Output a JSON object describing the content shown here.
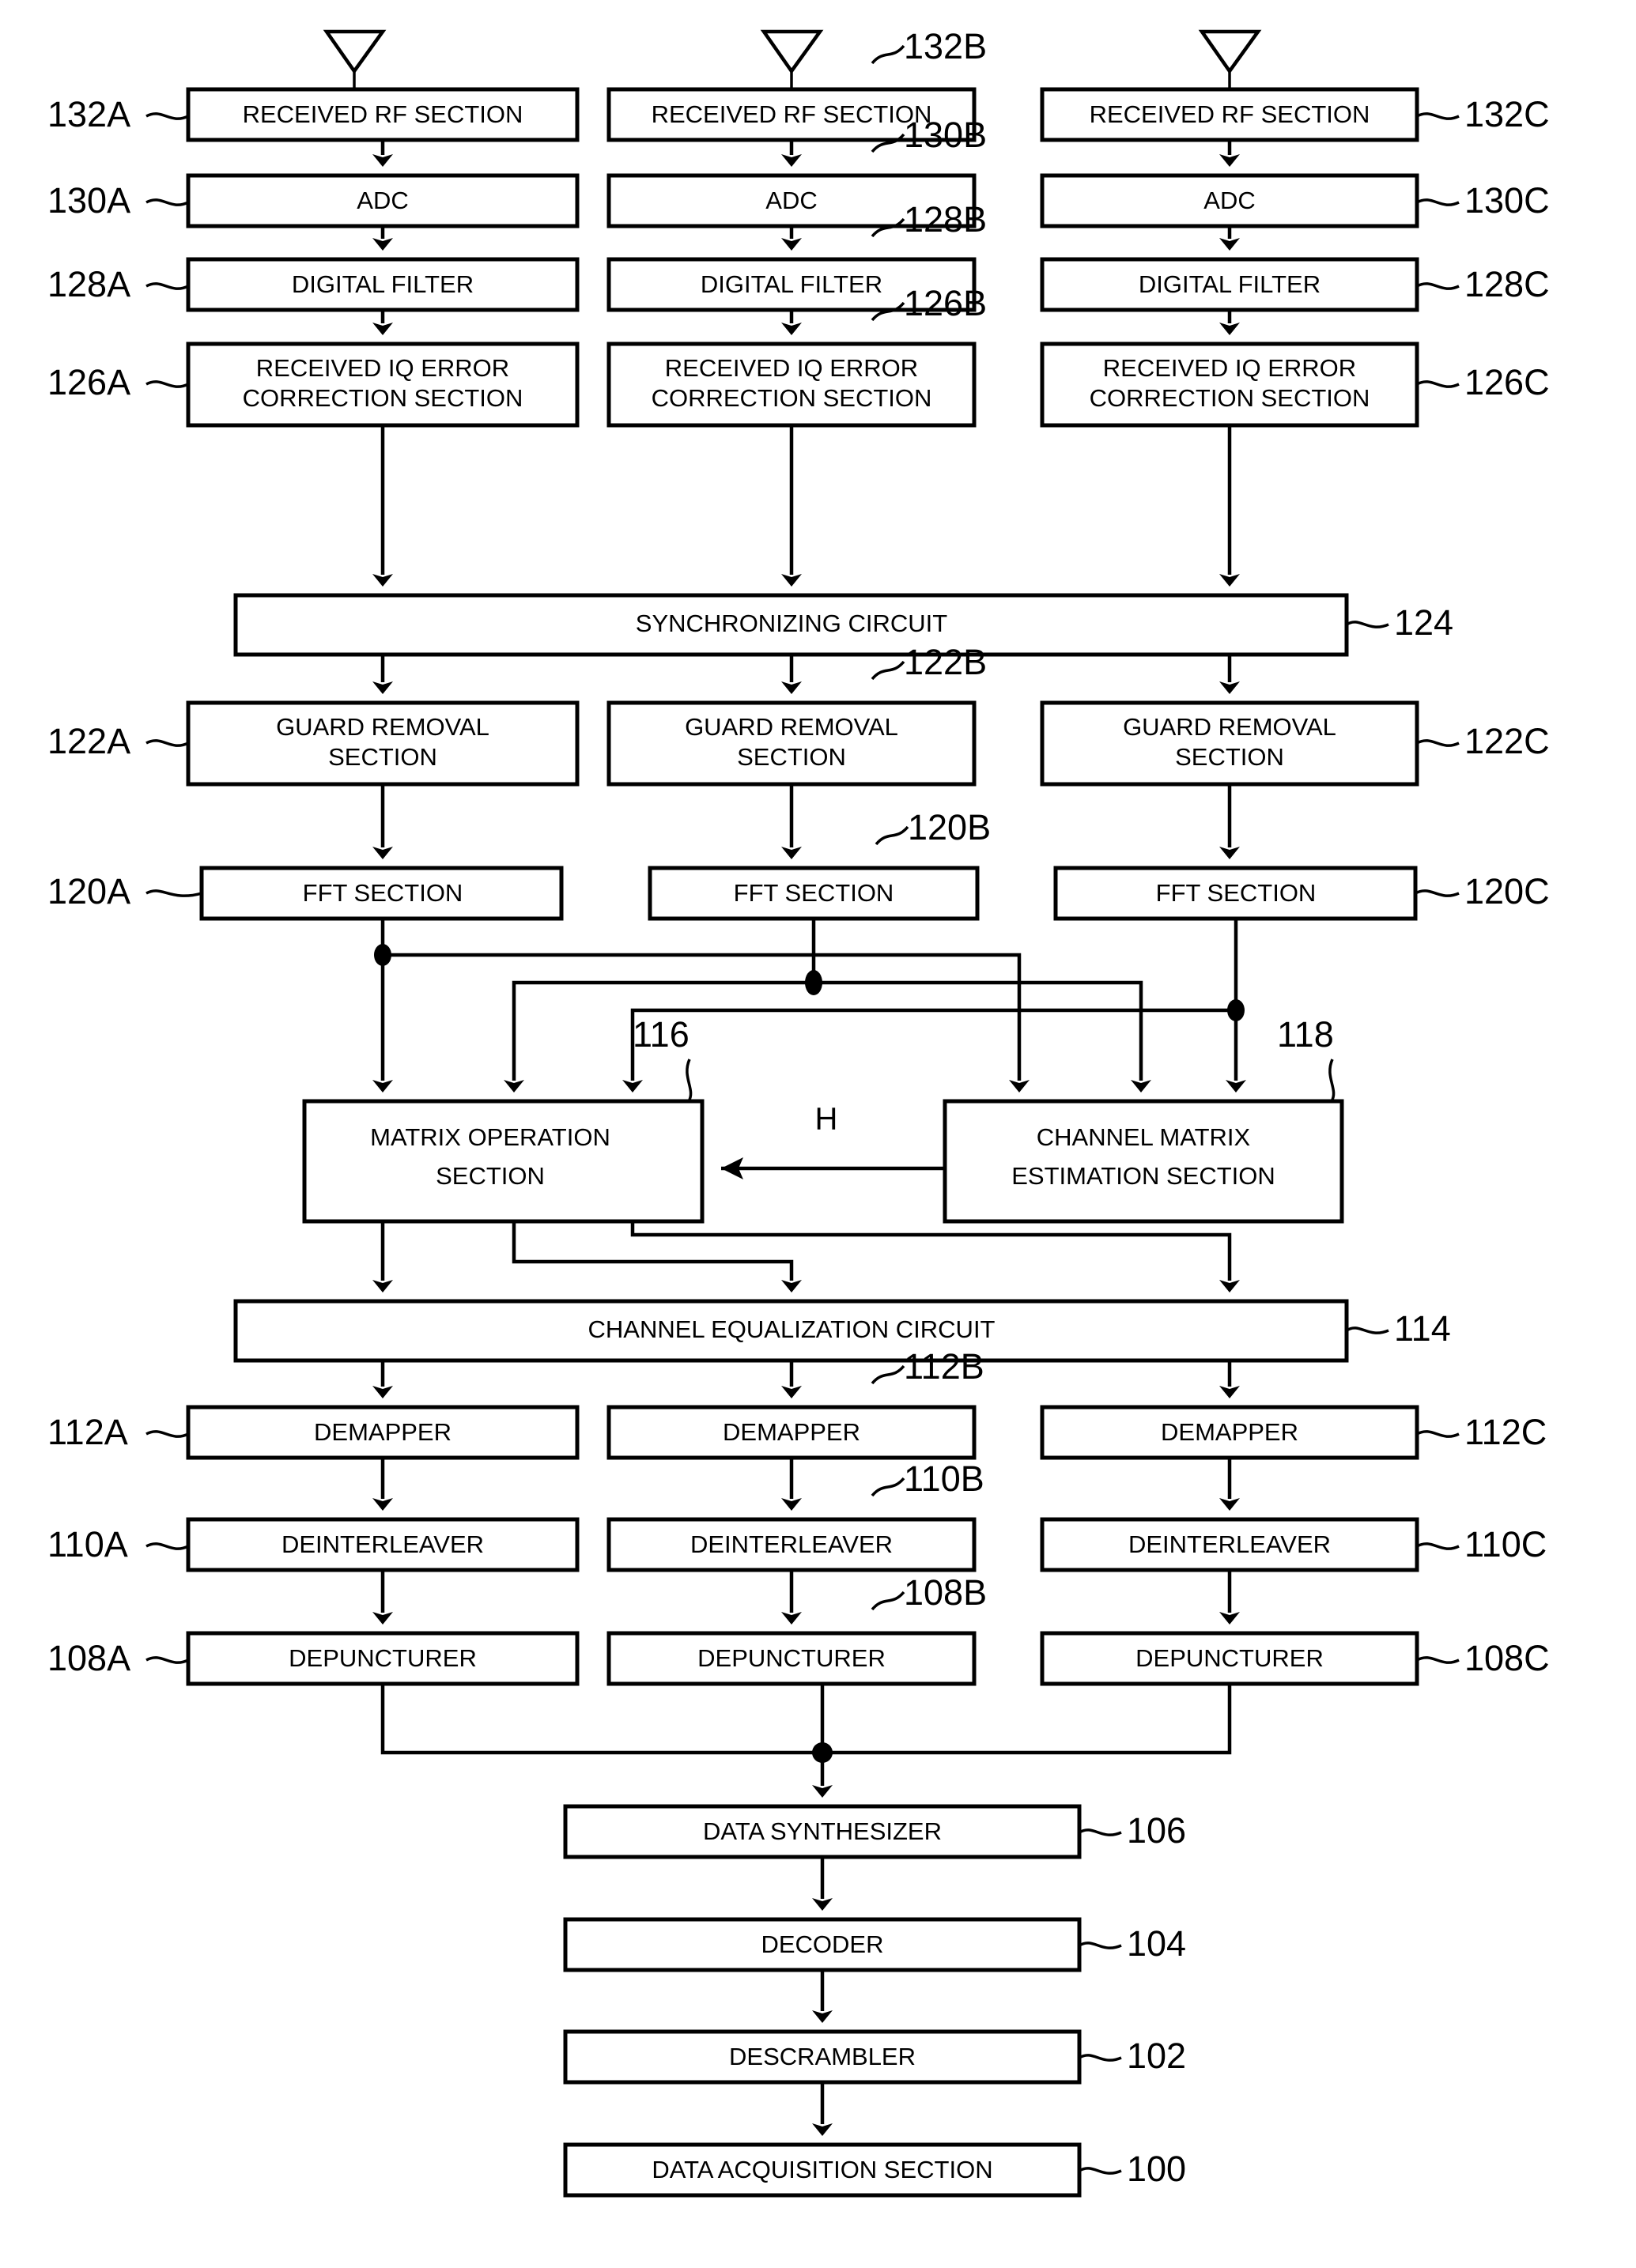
{
  "figure": {
    "type": "patent-block-diagram",
    "description": "MIMO OFDM receiver block diagram with three receive chains",
    "antenna_count": 3
  },
  "blocks": {
    "rf_a": {
      "label": "RECEIVED RF SECTION",
      "ref": "132A"
    },
    "rf_b": {
      "label": "RECEIVED RF SECTION",
      "ref": "132B"
    },
    "rf_c": {
      "label": "RECEIVED RF SECTION",
      "ref": "132C"
    },
    "adc_a": {
      "label": "ADC",
      "ref": "130A"
    },
    "adc_b": {
      "label": "ADC",
      "ref": "130B"
    },
    "adc_c": {
      "label": "ADC",
      "ref": "130C"
    },
    "df_a": {
      "label": "DIGITAL FILTER",
      "ref": "128A"
    },
    "df_b": {
      "label": "DIGITAL FILTER",
      "ref": "128B"
    },
    "df_c": {
      "label": "DIGITAL FILTER",
      "ref": "128C"
    },
    "iq_a": {
      "line1": "RECEIVED IQ ERROR",
      "line2": "CORRECTION SECTION",
      "ref": "126A"
    },
    "iq_b": {
      "line1": "RECEIVED IQ ERROR",
      "line2": "CORRECTION SECTION",
      "ref": "126B"
    },
    "iq_c": {
      "line1": "RECEIVED IQ ERROR",
      "line2": "CORRECTION SECTION",
      "ref": "126C"
    },
    "sync": {
      "label": "SYNCHRONIZING CIRCUIT",
      "ref": "124"
    },
    "gr_a": {
      "line1": "GUARD REMOVAL",
      "line2": "SECTION",
      "ref": "122A"
    },
    "gr_b": {
      "line1": "GUARD REMOVAL",
      "line2": "SECTION",
      "ref": "122B"
    },
    "gr_c": {
      "line1": "GUARD REMOVAL",
      "line2": "SECTION",
      "ref": "122C"
    },
    "fft_a": {
      "label": "FFT SECTION",
      "ref": "120A"
    },
    "fft_b": {
      "label": "FFT SECTION",
      "ref": "120B"
    },
    "fft_c": {
      "label": "FFT SECTION",
      "ref": "120C"
    },
    "matrix": {
      "line1": "MATRIX OPERATION",
      "line2": "SECTION",
      "ref": "116"
    },
    "chest": {
      "line1": "CHANNEL MATRIX",
      "line2": "ESTIMATION SECTION",
      "ref": "118"
    },
    "cheq": {
      "label": "CHANNEL EQUALIZATION CIRCUIT",
      "ref": "114"
    },
    "dem_a": {
      "label": "DEMAPPER",
      "ref": "112A"
    },
    "dem_b": {
      "label": "DEMAPPER",
      "ref": "112B"
    },
    "dem_c": {
      "label": "DEMAPPER",
      "ref": "112C"
    },
    "dei_a": {
      "label": "DEINTERLEAVER",
      "ref": "110A"
    },
    "dei_b": {
      "label": "DEINTERLEAVER",
      "ref": "110B"
    },
    "dei_c": {
      "label": "DEINTERLEAVER",
      "ref": "110C"
    },
    "dep_a": {
      "label": "DEPUNCTURER",
      "ref": "108A"
    },
    "dep_b": {
      "label": "DEPUNCTURER",
      "ref": "108B"
    },
    "dep_c": {
      "label": "DEPUNCTURER",
      "ref": "108C"
    },
    "dsyn": {
      "label": "DATA SYNTHESIZER",
      "ref": "106"
    },
    "dec": {
      "label": "DECODER",
      "ref": "104"
    },
    "descr": {
      "label": "DESCRAMBLER",
      "ref": "102"
    },
    "dacq": {
      "label": "DATA ACQUISITION SECTION",
      "ref": "100"
    }
  },
  "signals": {
    "h_label": "H"
  },
  "ref_markers": {
    "left_side": [
      "132A",
      "130A",
      "128A",
      "126A",
      "122A",
      "120A",
      "112A",
      "110A",
      "108A"
    ],
    "top_middle": [
      "132B",
      "130B",
      "128B",
      "126B",
      "122B",
      "120B",
      "112B",
      "110B",
      "108B"
    ],
    "right_side": [
      "132C",
      "130C",
      "128C",
      "126C",
      "124",
      "122C",
      "120C",
      "114",
      "112C",
      "110C",
      "108C",
      "106",
      "104",
      "102",
      "100"
    ],
    "inline": [
      "116",
      "118"
    ]
  },
  "colors": {
    "line": "#000000",
    "fill": "#ffffff"
  }
}
